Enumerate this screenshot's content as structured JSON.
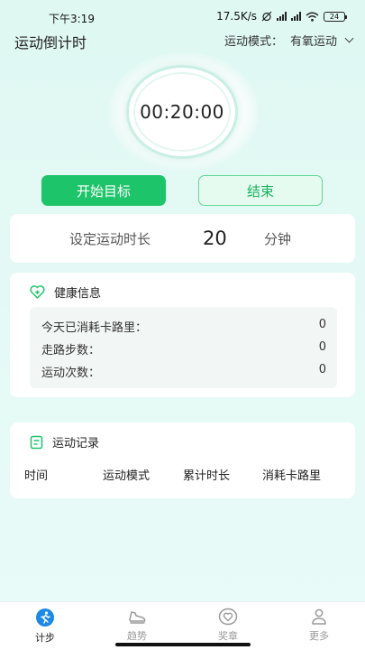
{
  "status": {
    "time": "下午3:19",
    "network_speed": "17.5K/s",
    "battery": "24"
  },
  "header": {
    "title": "运动倒计时",
    "mode_label": "运动模式：",
    "mode_value": "有氧运动"
  },
  "timer": {
    "display": "00:20:00"
  },
  "buttons": {
    "start": "开始目标",
    "end": "结束"
  },
  "duration": {
    "label": "设定运动时长",
    "value": "20",
    "unit": "分钟"
  },
  "health": {
    "title": "健康信息",
    "rows": [
      {
        "label": "今天已消耗卡路里：",
        "value": "0"
      },
      {
        "label": "走路步数：",
        "value": "0"
      },
      {
        "label": "运动次数：",
        "value": "0"
      }
    ]
  },
  "records": {
    "title": "运动记录",
    "columns": [
      "时间",
      "运动模式",
      "累计时长",
      "消耗卡路里"
    ]
  },
  "tabs": [
    {
      "label": "计步",
      "icon": "runner-icon",
      "active": true
    },
    {
      "label": "趋势",
      "icon": "shoe-icon",
      "active": false
    },
    {
      "label": "奖章",
      "icon": "medal-heart-icon",
      "active": false
    },
    {
      "label": "更多",
      "icon": "person-icon",
      "active": false
    }
  ],
  "colors": {
    "accent": "#1ec46a",
    "background": "#dff8f2"
  }
}
